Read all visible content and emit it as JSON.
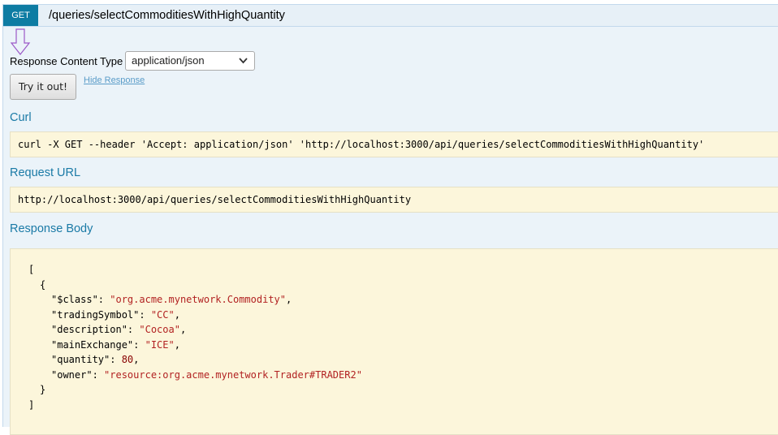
{
  "operation": {
    "method": "GET",
    "path": "/queries/selectCommoditiesWithHighQuantity"
  },
  "response_content_type": {
    "label": "Response Content Type",
    "selected": "application/json"
  },
  "actions": {
    "try_label": "Try it out!",
    "hide_label": "Hide Response"
  },
  "curl": {
    "title": "Curl",
    "command": "curl -X GET --header 'Accept: application/json' 'http://localhost:3000/api/queries/selectCommoditiesWithHighQuantity'"
  },
  "request_url": {
    "title": "Request URL",
    "value": "http://localhost:3000/api/queries/selectCommoditiesWithHighQuantity"
  },
  "response_body": {
    "title": "Response Body",
    "open_bracket": "[",
    "open_brace": "{",
    "fields": [
      {
        "key": "\"$class\"",
        "value": "\"org.acme.mynetwork.Commodity\"",
        "type": "string",
        "comma": ","
      },
      {
        "key": "\"tradingSymbol\"",
        "value": "\"CC\"",
        "type": "string",
        "comma": ","
      },
      {
        "key": "\"description\"",
        "value": "\"Cocoa\"",
        "type": "string",
        "comma": ","
      },
      {
        "key": "\"mainExchange\"",
        "value": "\"ICE\"",
        "type": "string",
        "comma": ","
      },
      {
        "key": "\"quantity\"",
        "value": "80",
        "type": "number",
        "comma": ","
      },
      {
        "key": "\"owner\"",
        "value": "\"resource:org.acme.mynetwork.Trader#TRADER2\"",
        "type": "string",
        "comma": ""
      }
    ],
    "close_brace": "}",
    "close_bracket": "]"
  },
  "colors": {
    "method_bg": "#0e7ca3",
    "section_title": "#1a7aa6",
    "code_bg": "#fcf6db",
    "string_value": "#b22222"
  }
}
